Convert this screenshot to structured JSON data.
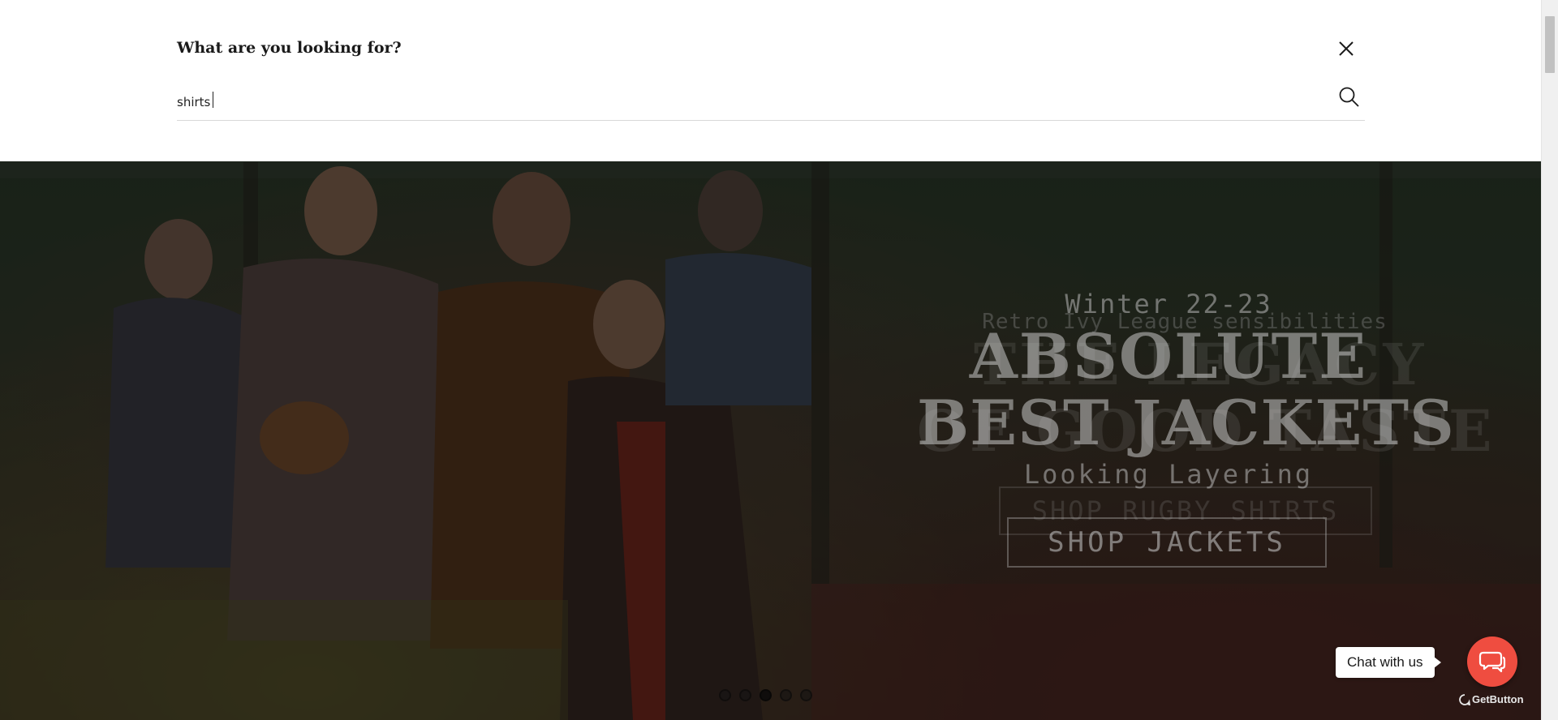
{
  "search": {
    "title": "What are you looking for?",
    "query": "shirts",
    "placeholder": ""
  },
  "hero": {
    "season": "Winter 22-23",
    "subtitle": "Retro Ivy League sensibilities",
    "headline_line1": "ABSOLUTE",
    "headline_line2": "BEST JACKETS",
    "background_headline_line1": "THE LEGACY",
    "background_headline_line2": "OF GOOD TASTE",
    "tagline": "Looking Layering",
    "background_button": "SHOP RUGBY SHIRTS",
    "button": "SHOP JACKETS",
    "slides": 5,
    "active_slide": 3
  },
  "chat": {
    "bubble": "Chat with us",
    "branding": "GetButton",
    "accent": "#ef4d40"
  },
  "icons": {
    "close": "close-icon",
    "search": "search-icon",
    "chat": "chat-icon"
  }
}
